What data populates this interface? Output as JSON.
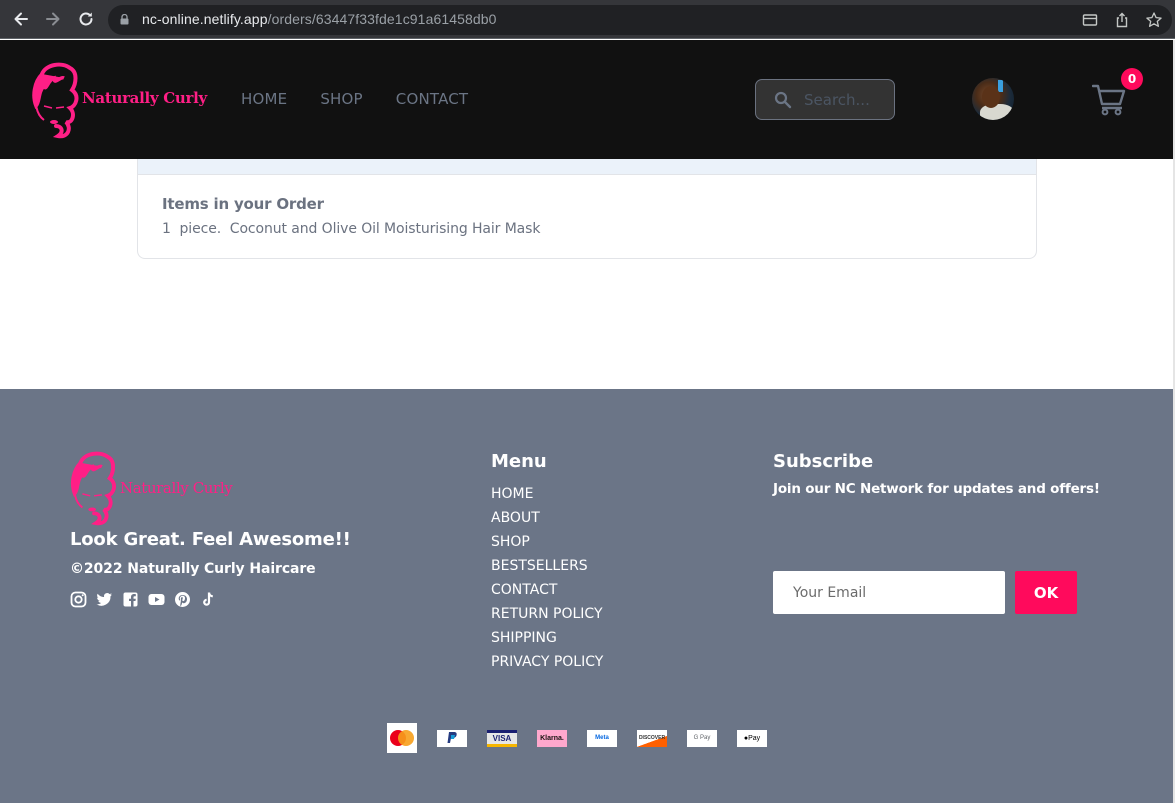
{
  "browser": {
    "url_host": "nc-online.netlify.app",
    "url_path": "/orders/63447f33fde1c91a61458db0",
    "icons": [
      "back-icon",
      "forward-icon",
      "reload-icon",
      "lock-icon",
      "tab-search-icon",
      "share-icon",
      "bookmark-star-icon"
    ]
  },
  "header": {
    "brand": "Naturally Curly",
    "nav": [
      {
        "label": "HOME"
      },
      {
        "label": "SHOP"
      },
      {
        "label": "CONTACT"
      }
    ],
    "search": {
      "placeholder": "Search...",
      "value": ""
    },
    "cart_count": "0"
  },
  "order": {
    "items_title": "Items in your Order",
    "items": [
      {
        "quantity": "1",
        "unit": "piece.",
        "name": "Coconut and Olive Oil Moisturising Hair Mask"
      }
    ]
  },
  "footer": {
    "brand": "Naturally Curly",
    "tagline": "Look Great. Feel Awesome!!",
    "copyright": "©2022 Naturally Curly Haircare",
    "socials": [
      "instagram",
      "twitter",
      "facebook",
      "youtube",
      "pinterest",
      "tiktok"
    ],
    "menu": {
      "title": "Menu",
      "items": [
        {
          "label": "HOME"
        },
        {
          "label": "ABOUT"
        },
        {
          "label": "SHOP"
        },
        {
          "label": "BESTSELLERS"
        },
        {
          "label": "CONTACT"
        },
        {
          "label": "RETURN POLICY"
        },
        {
          "label": "SHIPPING"
        },
        {
          "label": "PRIVACY POLICY"
        }
      ]
    },
    "subscribe": {
      "title": "Subscribe",
      "text": "Join our NC Network for updates and offers!",
      "email_placeholder": "Your Email",
      "email_value": "",
      "button_label": "OK"
    },
    "payments": [
      {
        "name": "MasterCard",
        "label": "MasterCard"
      },
      {
        "name": "PayPal",
        "label": "PayPal"
      },
      {
        "name": "Visa",
        "label": "VISA"
      },
      {
        "name": "Klarna",
        "label": "Klarna."
      },
      {
        "name": "Meta Pay",
        "label": "Meta"
      },
      {
        "name": "Discover",
        "label": "DISCOVER"
      },
      {
        "name": "Google Pay",
        "label": "G Pay"
      },
      {
        "name": "Apple Pay",
        "label": "Pay"
      }
    ]
  },
  "colors": {
    "accent": "#ff0a5c",
    "brand_pink": "#ff1f86",
    "header_bg": "#111111",
    "footer_bg": "#6b7587",
    "nav_text": "#6b7585"
  }
}
